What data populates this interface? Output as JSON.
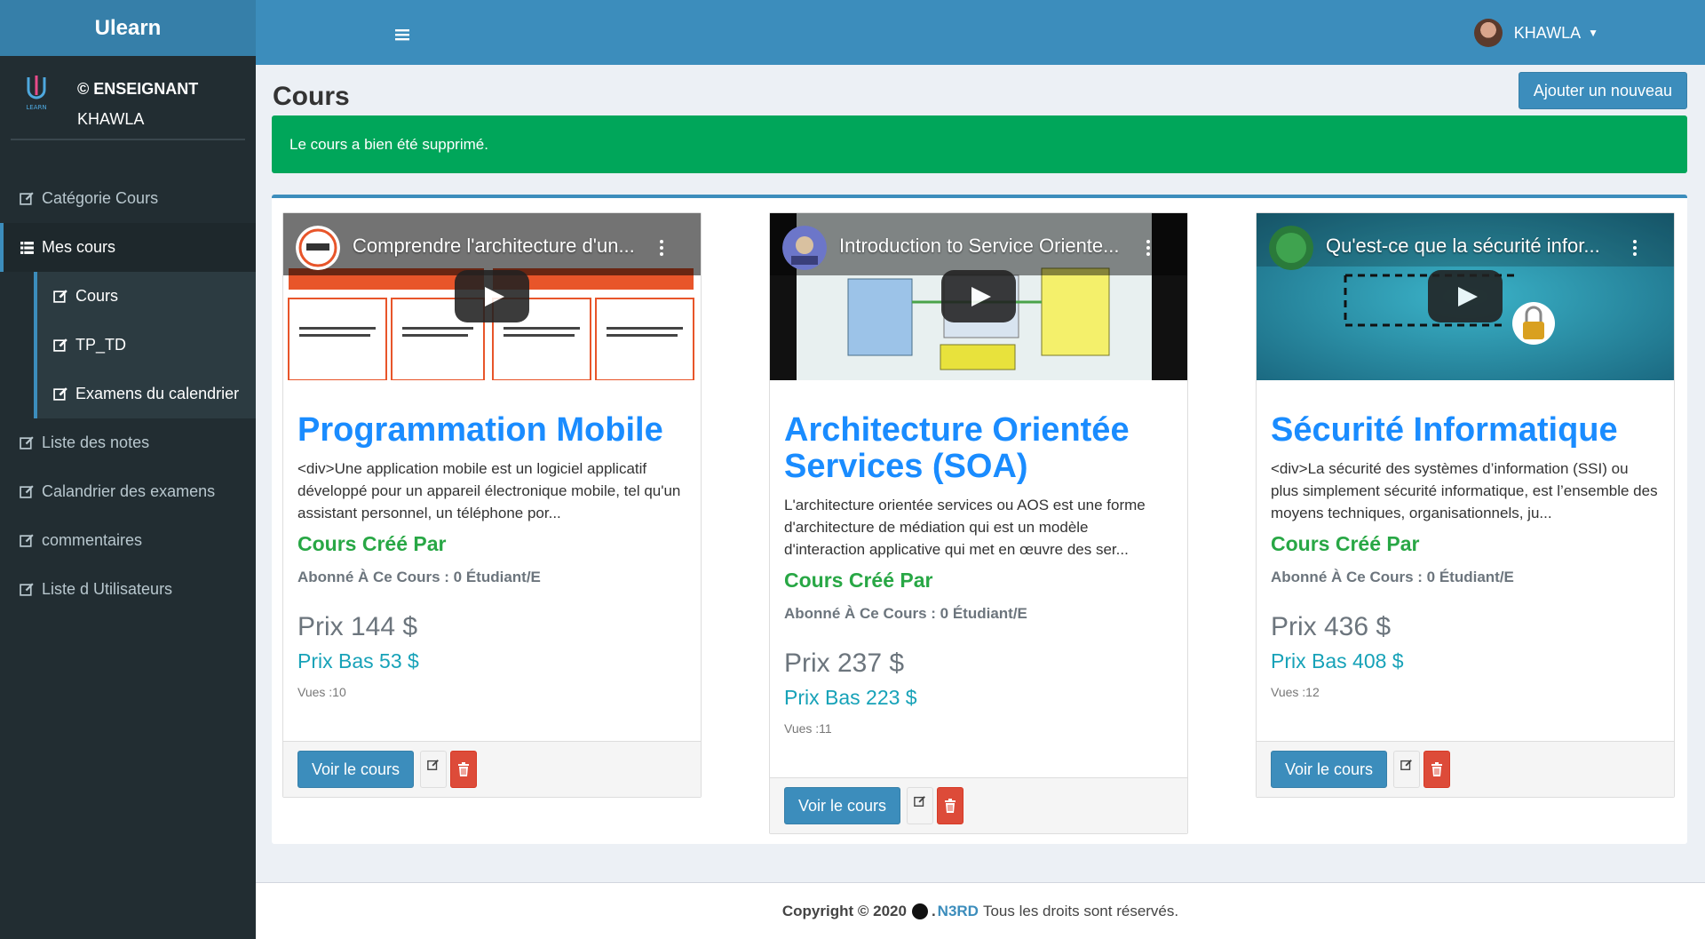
{
  "brand": "Ulearn",
  "user": {
    "role": "© ENSEIGNANT",
    "name": "KHAWLA",
    "top_name": "KHAWLA"
  },
  "sidebar": {
    "items": [
      {
        "label": "Catégorie Cours"
      },
      {
        "label": "Mes cours"
      },
      {
        "label": "Liste des notes"
      },
      {
        "label": "Calandrier des examens"
      },
      {
        "label": "commentaires"
      },
      {
        "label": "Liste d Utilisateurs"
      }
    ],
    "submenu": [
      {
        "label": "Cours"
      },
      {
        "label": "TP_TD"
      },
      {
        "label": "Examens du calendrier"
      }
    ]
  },
  "page": {
    "title": "Cours",
    "add_button": "Ajouter un nouveau",
    "alert": "Le cours a bien été supprimé."
  },
  "courses": [
    {
      "video_title": "Comprendre l'architecture d'un...",
      "title": "Programmation Mobile",
      "description": "<div>Une application mobile est un logiciel applicatif développé pour un appareil électronique mobile, tel qu'un assistant personnel, un téléphone por...",
      "created_by": "Cours Créé Par",
      "subscribers": "Abonné À Ce Cours : 0 Étudiant/E",
      "price": "Prix 144 $",
      "low_price": "Prix Bas 53 $",
      "views": "Vues :10",
      "view_button": "Voir le cours"
    },
    {
      "video_title": "Introduction to Service Oriente...",
      "title": "Architecture Orientée Services (SOA)",
      "description": "L'architecture orientée services ou AOS est une forme d'architecture de médiation qui est un modèle d'interaction applicative qui met en œuvre des ser...",
      "created_by": "Cours Créé Par",
      "subscribers": "Abonné À Ce Cours : 0 Étudiant/E",
      "price": "Prix 237 $",
      "low_price": "Prix Bas 223 $",
      "views": "Vues :11",
      "view_button": "Voir le cours"
    },
    {
      "video_title": "Qu'est-ce que la sécurité infor...",
      "title": "Sécurité Informatique",
      "description": "<div>La sécurité des systèmes d’information (SSI) ou plus simplement sécurité informatique, est l’ensemble des moyens techniques, organisationnels, ju...",
      "created_by": "Cours Créé Par",
      "subscribers": "Abonné À Ce Cours : 0 Étudiant/E",
      "price": "Prix 436 $",
      "low_price": "Prix Bas 408 $",
      "views": "Vues :12",
      "view_button": "Voir le cours"
    }
  ],
  "footer": {
    "copyright": "Copyright © 2020",
    "brand": "N3RD",
    "rights": "Tous les droits sont réservés."
  },
  "colors": {
    "primary": "#3c8dbc",
    "sidebar": "#222d32",
    "success": "#00a65a",
    "danger": "#dd4b39",
    "course_title": "#1a8cff"
  }
}
